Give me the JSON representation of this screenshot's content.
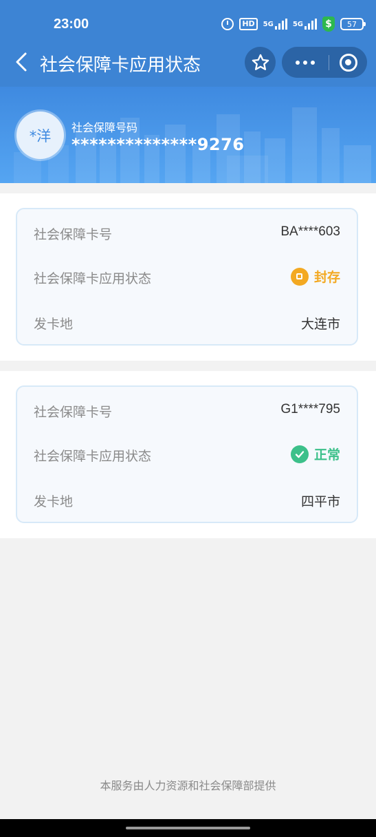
{
  "status_bar": {
    "time": "23:00",
    "hd_label": "HD",
    "net1_label": "5G",
    "net2_label": "5G",
    "shield_symbol": "$",
    "battery": "57"
  },
  "header": {
    "title": "社会保障卡应用状态",
    "back_icon": "chevron-left-icon",
    "favorite_icon": "star-icon",
    "more_icon": "more-dots-icon",
    "close_icon": "target-close-icon"
  },
  "profile": {
    "avatar_text": "*洋",
    "ssn_label": "社会保障号码",
    "ssn_value": "**************9276"
  },
  "cards": [
    {
      "card_no_label": "社会保障卡号",
      "card_no": "BA****603",
      "status_label": "社会保障卡应用状态",
      "status": "封存",
      "status_color": "#f3a922",
      "issuer_label": "发卡地",
      "issuer": "大连市"
    },
    {
      "card_no_label": "社会保障卡号",
      "card_no": "G1****795",
      "status_label": "社会保障卡应用状态",
      "status": "正常",
      "status_color": "#3cc08a",
      "issuer_label": "发卡地",
      "issuer": "四平市"
    }
  ],
  "footer": {
    "note": "本服务由人力资源和社会保障部提供"
  },
  "colors": {
    "brand_blue": "#3d84d4",
    "capsule_blue": "#2b64a6"
  }
}
